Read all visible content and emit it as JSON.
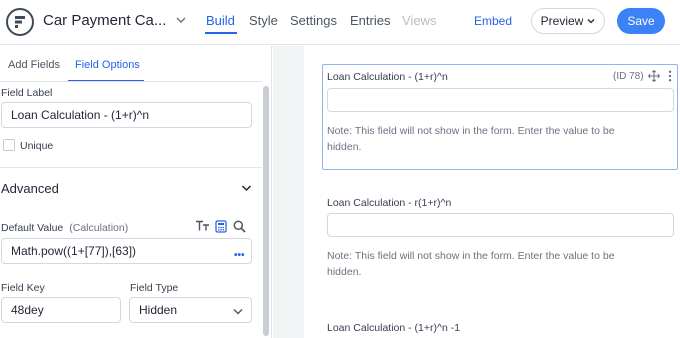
{
  "header": {
    "form_title": "Car Payment Ca...",
    "tabs": [
      "Build",
      "Style",
      "Settings",
      "Entries",
      "Views"
    ],
    "embed_label": "Embed",
    "preview_label": "Preview",
    "save_label": "Save"
  },
  "sidebar": {
    "tabs": [
      "Add Fields",
      "Field Options"
    ],
    "field_label_label": "Field Label",
    "field_label_value": "Loan Calculation - (1+r)^n",
    "unique_label": "Unique",
    "advanced_title": "Advanced",
    "default_value_label": "Default Value",
    "default_value_mode": "(Calculation)",
    "default_value": "Math.pow((1+[77]),[63])",
    "more_dots": "•••",
    "field_key_label": "Field Key",
    "field_key_value": "48dey",
    "field_type_label": "Field Type",
    "field_type_value": "Hidden"
  },
  "canvas": {
    "fields": [
      {
        "label": "Loan Calculation - (1+r)^n",
        "id_label": "(ID 78)",
        "note": "Note: This field will not show in the form. Enter the value to be hidden."
      },
      {
        "label": "Loan Calculation - r(1+r)^n",
        "note": "Note: This field will not show in the form. Enter the value to be hidden."
      },
      {
        "label": "Loan Calculation - (1+r)^n -1"
      }
    ]
  },
  "colors": {
    "accent": "#2563eb",
    "save_button": "#3b82f6",
    "selected_border": "#93b4f0"
  },
  "icons": [
    "formidable-logo-icon",
    "chevron-down-icon",
    "text-format-icon",
    "calculator-icon",
    "search-icon",
    "move-icon",
    "more-vertical-icon"
  ]
}
